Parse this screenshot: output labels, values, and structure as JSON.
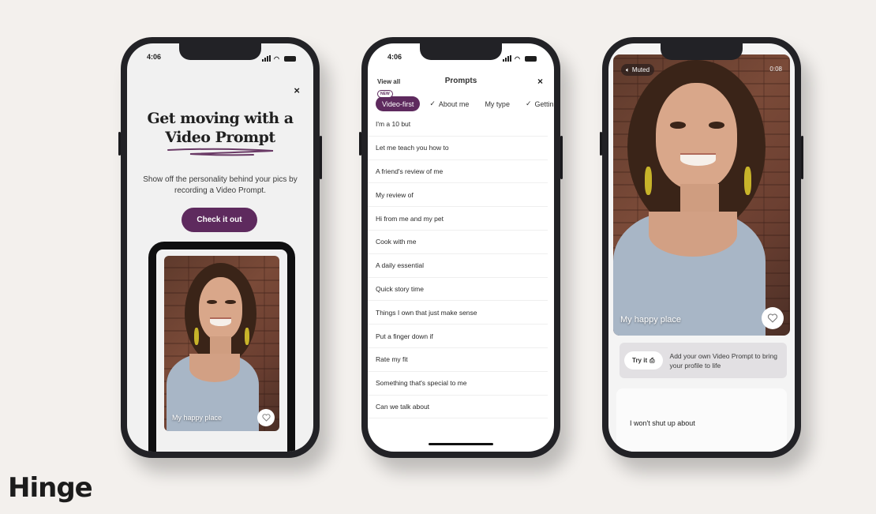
{
  "brand": {
    "logo": "Hinge",
    "accent": "#5e2a5e"
  },
  "status_bar": {
    "time": "4:06"
  },
  "phone1": {
    "close_icon": "×",
    "title_line1": "Get moving with a",
    "title_line2": "Video Prompt",
    "description": "Show off the personality behind your pics by recording a Video Prompt.",
    "cta_label": "Check it out",
    "preview_caption": "My happy place"
  },
  "phone2": {
    "view_all": "View all",
    "title": "Prompts",
    "close_icon": "×",
    "new_badge": "NEW",
    "chips": [
      {
        "label": "Video-first",
        "checked": false,
        "active": true
      },
      {
        "label": "About me",
        "checked": true,
        "active": false
      },
      {
        "label": "My type",
        "checked": false,
        "active": false
      },
      {
        "label": "Gettin",
        "checked": true,
        "active": false
      }
    ],
    "prompts": [
      "I'm a 10 but",
      "Let me teach you how to",
      "A friend's review of me",
      "My review of",
      "Hi from me and my pet",
      "Cook with me",
      "A daily essential",
      "Quick story time",
      "Things I own that just make sense",
      "Put a finger down if",
      "Rate my fit",
      "Something that's special to me",
      "Can we talk about"
    ]
  },
  "phone3": {
    "muted_label": "Muted",
    "timer": "0:08",
    "caption": "My happy place",
    "try_label": "Try it",
    "try_text": "Add your own Video Prompt to bring your profile to life",
    "next_prompt": "I won't shut up about"
  }
}
